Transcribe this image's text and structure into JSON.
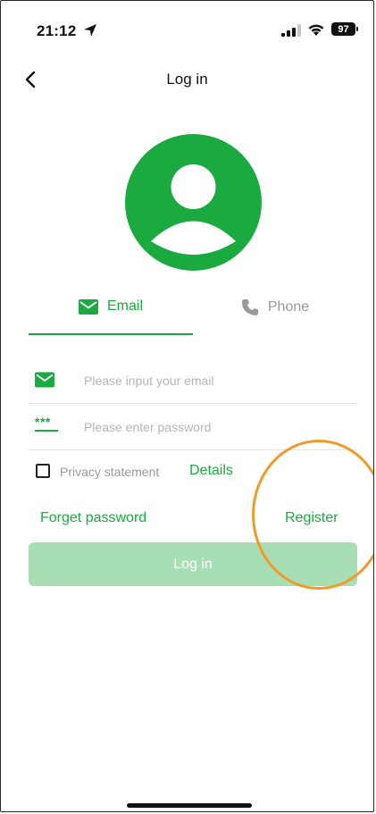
{
  "status_bar": {
    "time": "21:12",
    "battery": "97"
  },
  "nav": {
    "title": "Log in"
  },
  "tabs": [
    {
      "label": "Email",
      "icon": "envelope-icon",
      "active": true
    },
    {
      "label": "Phone",
      "icon": "phone-icon",
      "active": false
    }
  ],
  "form": {
    "email_placeholder": "Please input your email",
    "email_value": "",
    "password_placeholder": "Please enter password",
    "password_value": "",
    "password_icon_text": "***"
  },
  "privacy": {
    "label": "Privacy statement",
    "details": "Details",
    "checked": false
  },
  "links": {
    "forget_password": "Forget password",
    "register": "Register"
  },
  "login_button": {
    "label": "Log in"
  },
  "colors": {
    "accent": "#1aaa3f",
    "button_disabled": "#a8deb3",
    "annotation": "#f19a2a"
  }
}
